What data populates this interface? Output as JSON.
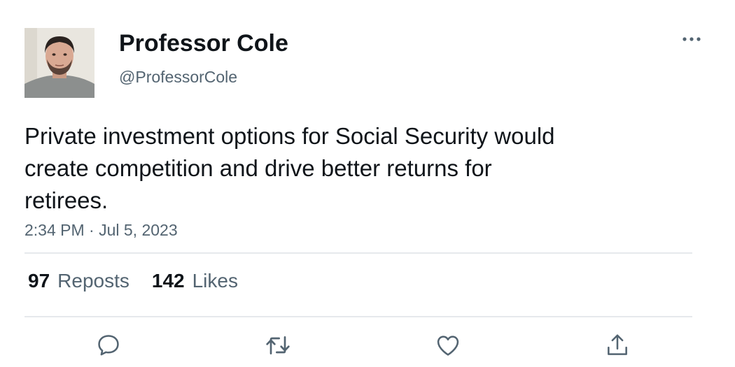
{
  "author": {
    "display_name": "Professor Cole",
    "handle": "@ProfessorCole"
  },
  "tweet": {
    "text": "Private investment options for Social Security would\ncreate competition and drive better returns for\nretirees.",
    "timestamp": "2:34 PM · Jul 5, 2023"
  },
  "stats": {
    "reposts_count": "97",
    "reposts_label": "Reposts",
    "likes_count": "142",
    "likes_label": "Likes"
  },
  "icons": {
    "more": "more-horizontal-icon",
    "reply": "reply-icon",
    "repost": "repost-icon",
    "like": "heart-icon",
    "share": "share-icon"
  },
  "colors": {
    "text_primary": "#0f1419",
    "text_secondary": "#536471",
    "divider": "#e6e9ec"
  }
}
